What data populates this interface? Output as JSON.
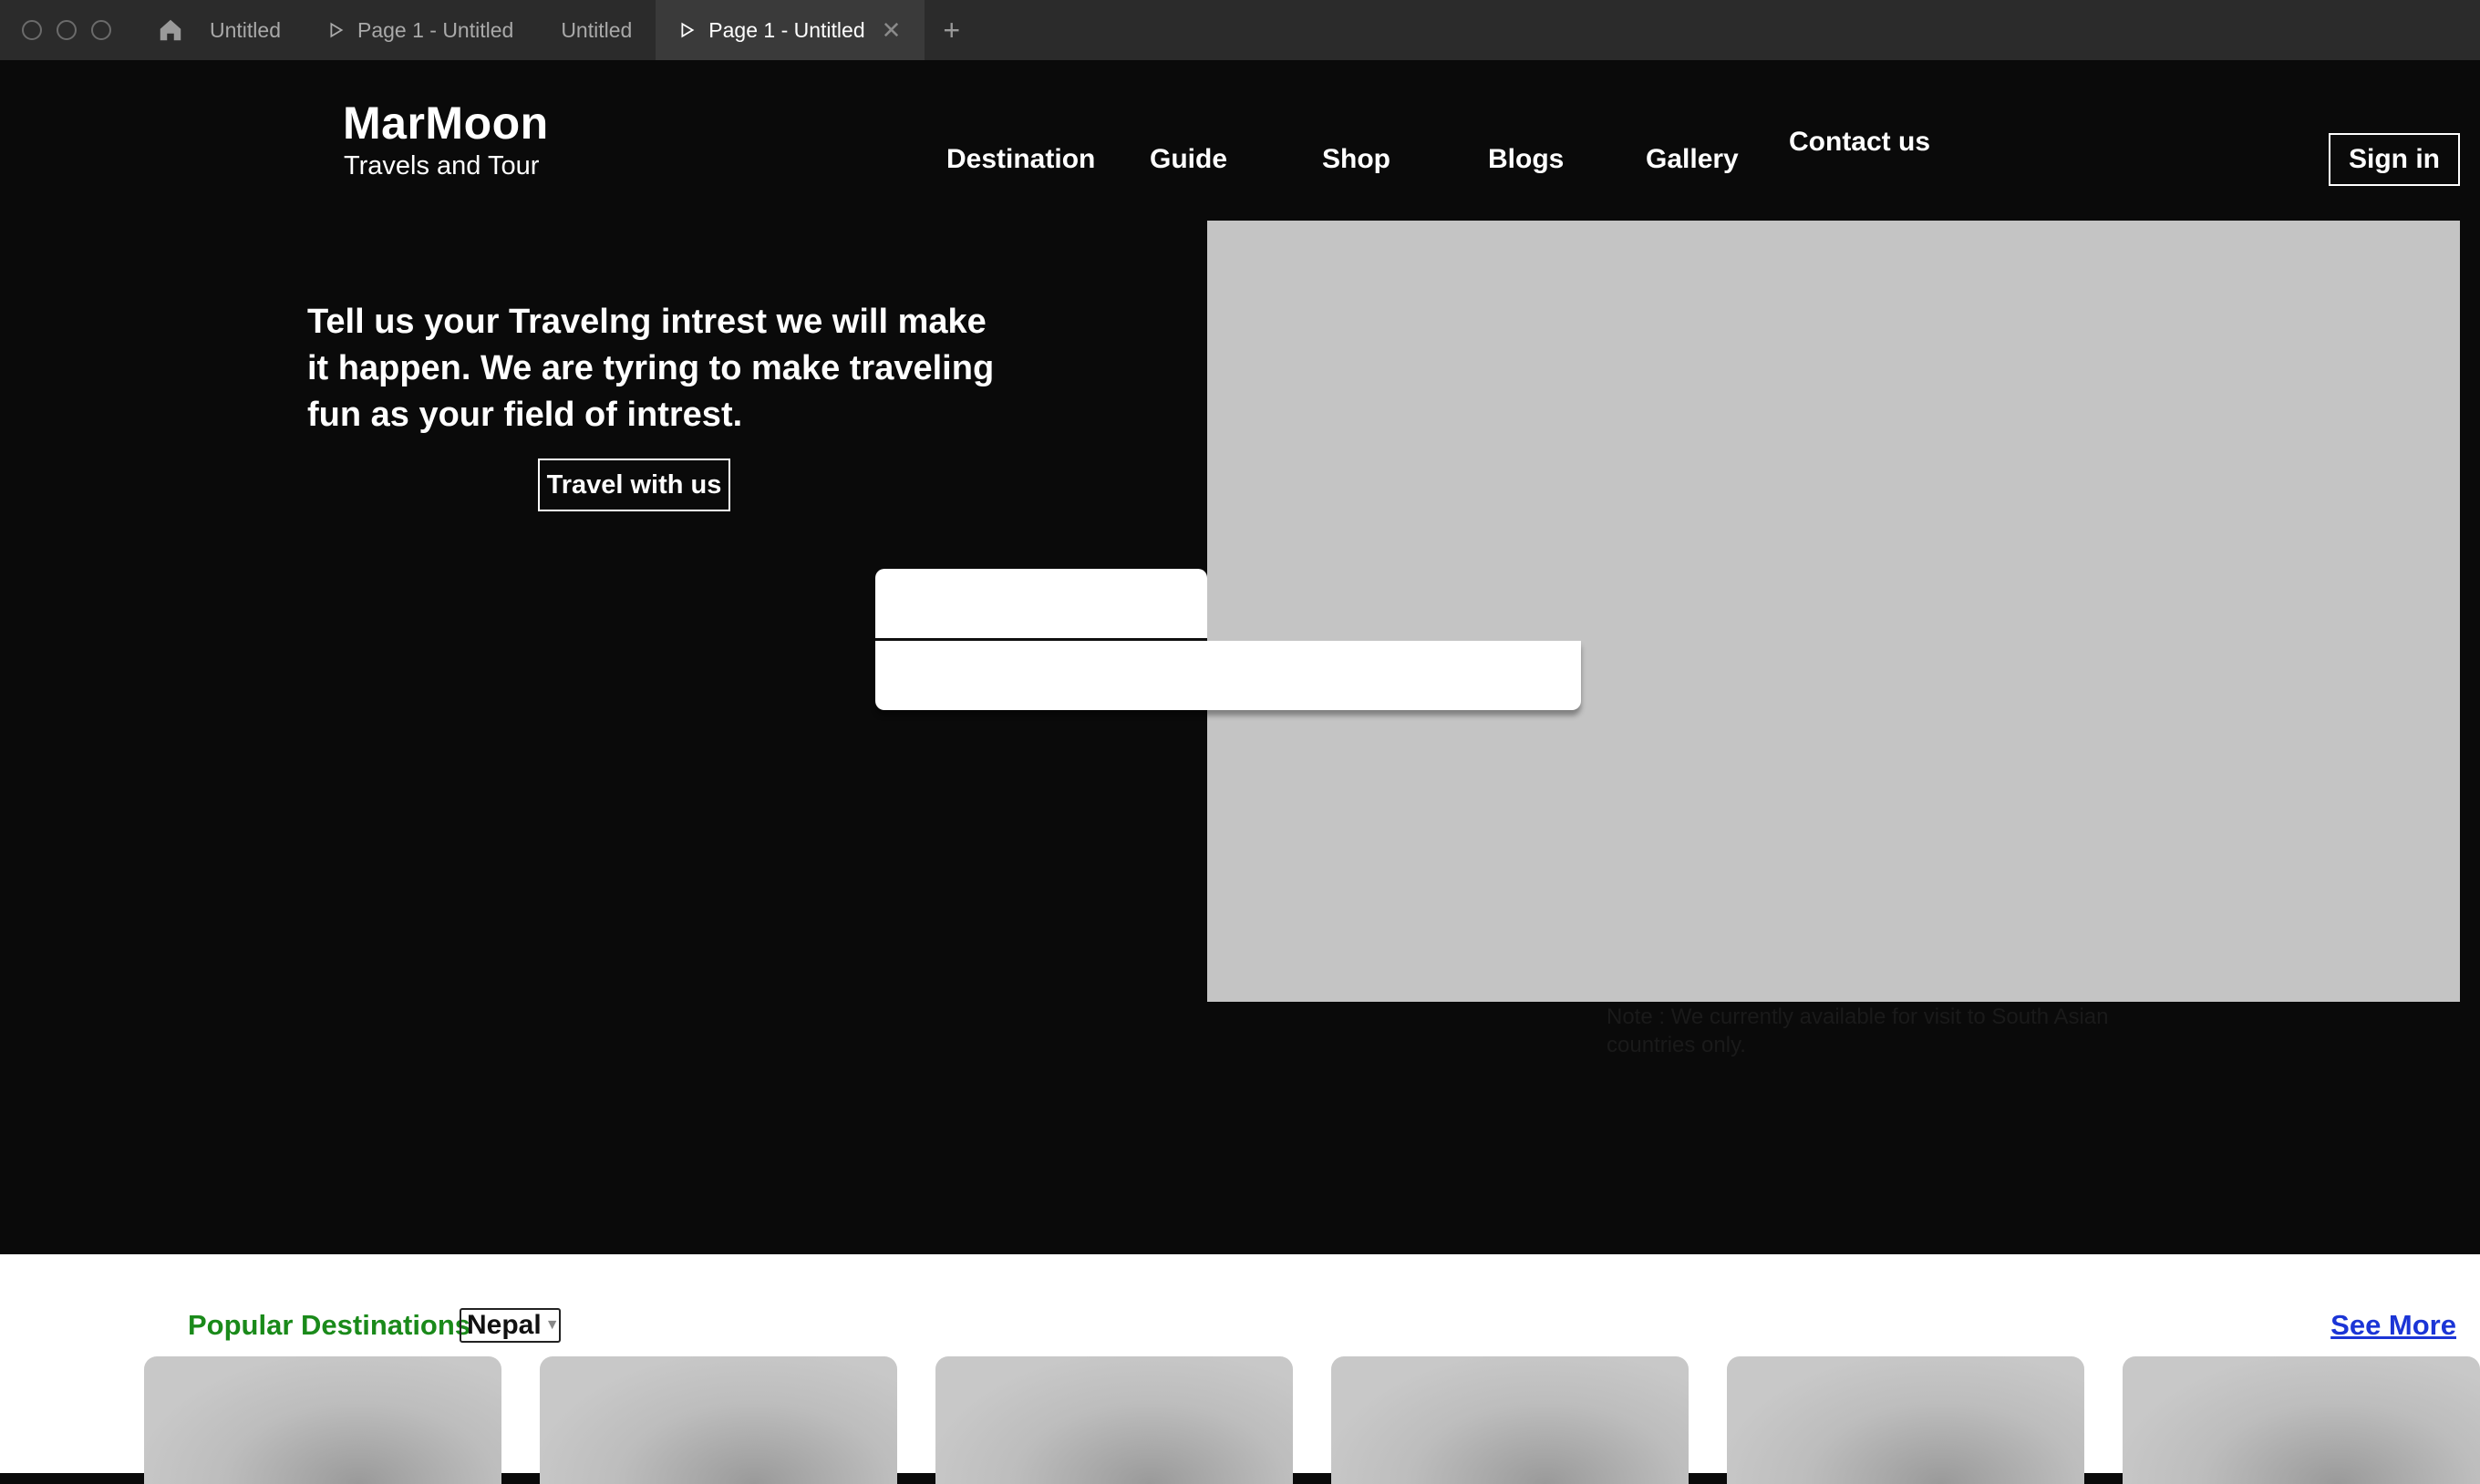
{
  "tabs": [
    {
      "label": "Untitled",
      "active": false,
      "has_play_icon": false
    },
    {
      "label": "Page 1 - Untitled",
      "active": false,
      "has_play_icon": true
    },
    {
      "label": "Untitled",
      "active": false,
      "has_play_icon": false
    },
    {
      "label": "Page 1 - Untitled",
      "active": true,
      "has_play_icon": true
    }
  ],
  "tab_add_label": "+",
  "tab_close_label": "✕",
  "brand": {
    "title": "MarMoon",
    "subtitle": "Travels and Tour"
  },
  "nav": [
    "Destination",
    "Guide",
    "Shop",
    "Blogs",
    "Gallery",
    "Contact us"
  ],
  "signin_label": "Sign in",
  "hero": {
    "text": "Tell us your Travelng intrest we will make it happen. We are tyring to make traveling fun as your field of intrest.",
    "cta_label": "Travel with us",
    "note": "Note : We currently available for visit to South Asian countries only."
  },
  "popular": {
    "title": "Popular Destinations",
    "selected_country": "Nepal",
    "see_more_label": "See More",
    "card_count": 6
  },
  "colors": {
    "hero_bg": "#0a0a0a",
    "image_placeholder": "#c4c4c4",
    "popular_title": "#1a8a1a",
    "see_more_link": "#1b35d6",
    "tabbar_bg": "#2b2b2b"
  }
}
